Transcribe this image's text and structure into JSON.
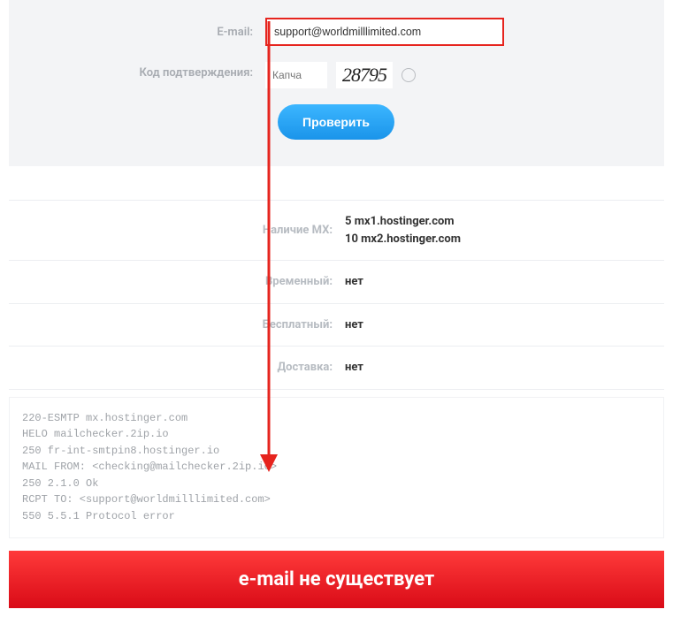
{
  "form": {
    "emailLabel": "E-mail:",
    "emailValue": "support@worldmilllimited.com",
    "captchaLabel": "Код подтверждения:",
    "captchaPlaceholder": "Капча",
    "captchaCode": "28795",
    "submit": "Проверить"
  },
  "results": {
    "mxLabel": "Наличие MX:",
    "mxValues": [
      "5 mx1.hostinger.com",
      "10 mx2.hostinger.com"
    ],
    "tempLabel": "Временный:",
    "tempValue": "нет",
    "freeLabel": "Бесплатный:",
    "freeValue": "нет",
    "deliveryLabel": "Доставка:",
    "deliveryValue": "нет"
  },
  "log": "220-ESMTP mx.hostinger.com\nHELO mailchecker.2ip.io\n250 fr-int-smtpin8.hostinger.io\nMAIL FROM: <checking@mailchecker.2ip.io>\n250 2.1.0 Ok\nRCPT TO: <support@worldmilllimited.com>\n550 5.5.1 Protocol error",
  "alert": "e-mail не существует",
  "colors": {
    "highlight": "#e6241e",
    "button": "#2aa4f4",
    "alertBg": "#d90b17"
  }
}
